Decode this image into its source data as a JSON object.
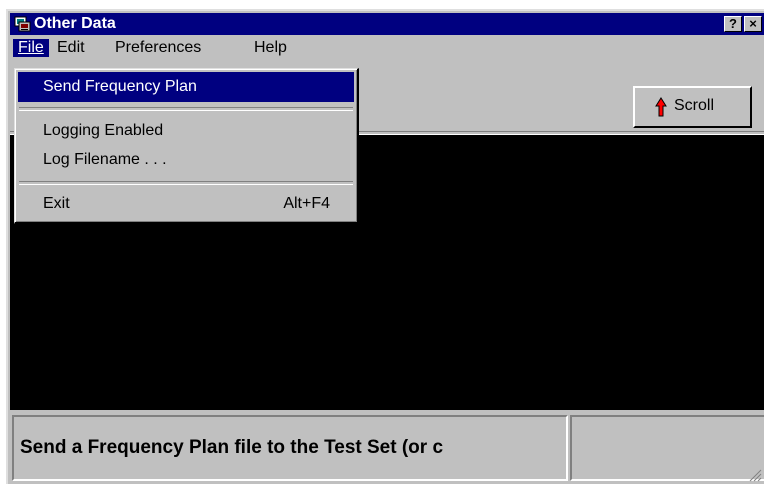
{
  "window": {
    "title": "Other Data",
    "help_button": "?",
    "close_button": "×"
  },
  "menubar": {
    "items": [
      {
        "label": "File",
        "active": true
      },
      {
        "label": "Edit",
        "active": false
      },
      {
        "label": "Preferences",
        "active": false
      },
      {
        "label": "Help",
        "active": false
      }
    ]
  },
  "file_menu": {
    "items": [
      {
        "label": "Send Frequency Plan",
        "accelerator": "",
        "selected": true
      },
      {
        "label": "Logging Enabled",
        "accelerator": "",
        "selected": false
      },
      {
        "label": "Log Filename . . .",
        "accelerator": "",
        "selected": false
      },
      {
        "label": "Exit",
        "accelerator": "Alt+F4",
        "selected": false
      }
    ]
  },
  "toolbar": {
    "scroll_label": "Scroll",
    "scroll_icon": "red-up-arrow-icon"
  },
  "statusbar": {
    "message": "Send a Frequency Plan file to the Test Set (or c",
    "secondary": ""
  },
  "colors": {
    "titlebar": "#000080",
    "face": "#c0c0c0",
    "output_bg": "#000000",
    "highlight": "#000080",
    "arrow": "#ff0000"
  }
}
